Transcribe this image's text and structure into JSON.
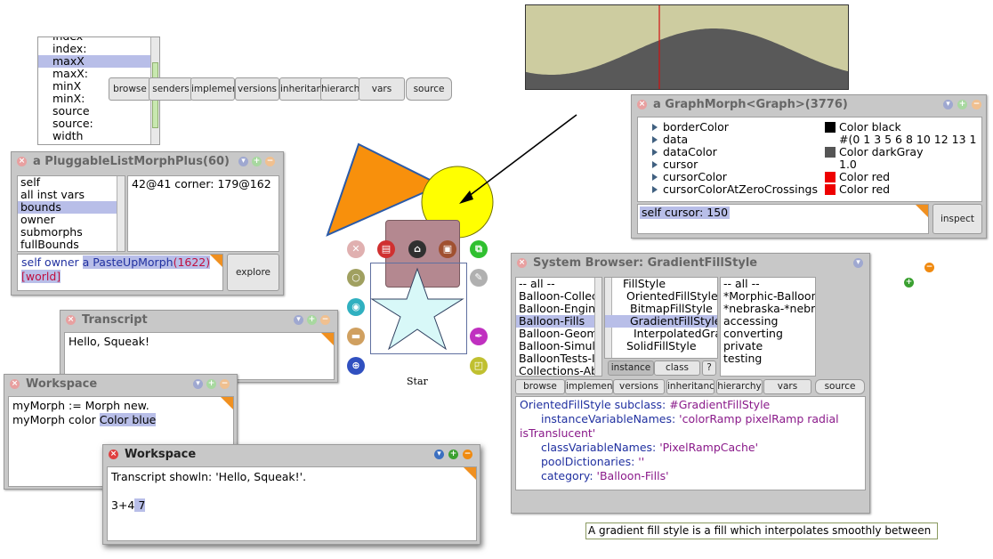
{
  "inspector_list": {
    "items": [
      "index",
      "index:",
      "maxX",
      "maxX:",
      "minX",
      "minX:",
      "source",
      "source:",
      "width"
    ],
    "selected_index": 2
  },
  "top_buttons": [
    "browse",
    "senders",
    "implementors",
    "versions",
    "inheritance",
    "hierarchy",
    "vars",
    "source"
  ],
  "graph_display": {
    "bg_color": "#cdcca0",
    "wave_color": "#595959",
    "cursor_color": "#d01010"
  },
  "graph_inspector": {
    "title": "a GraphMorph<Graph>(3776)",
    "fields": [
      {
        "name": "borderColor",
        "value": "Color black",
        "swatch": "#000000"
      },
      {
        "name": "data",
        "value": "#(0 1 3 5 6 8 10 12 13 1",
        "swatch": ""
      },
      {
        "name": "dataColor",
        "value": "Color darkGray",
        "swatch": "#555555"
      },
      {
        "name": "cursor",
        "value": "1.0",
        "swatch": ""
      },
      {
        "name": "cursorColor",
        "value": "Color red",
        "swatch": "#ee0000"
      },
      {
        "name": "cursorColorAtZeroCrossings",
        "value": "Color red",
        "swatch": "#ee0000"
      }
    ],
    "code": "self cursor: 150",
    "inspect_label": "inspect"
  },
  "pluggable_inspector": {
    "title": "a PluggableListMorphPlus(60)",
    "fields": [
      "self",
      "all inst vars",
      "bounds",
      "owner",
      "submorphs",
      "fullBounds"
    ],
    "selected_index": 2,
    "value": "42@41 corner: 179@162",
    "code_self_owner": "self owner",
    "code_result": "a PasteUpMorph(1622)",
    "code_result_plain": "a PasteUpMorph",
    "code_result_num": "(1622)",
    "code_world": "[world]",
    "explore_label": "explore"
  },
  "transcript": {
    "title": "Transcript",
    "text": "Hello, Squeak!"
  },
  "workspace_back": {
    "title": "Workspace",
    "line1": "myMorph := Morph new.",
    "line2_a": "myMorph color ",
    "line2_b": "Color blue"
  },
  "workspace_front": {
    "title": "Workspace",
    "line1": "Transcript showln: 'Hello, Squeak!'.",
    "line3_a": "3+4",
    "line3_b": " 7"
  },
  "star_morph": {
    "label": "Star",
    "fill": "#d8f8f8"
  },
  "halo_handles": [
    {
      "name": "close-handle-icon",
      "glyph": "✕",
      "color": "#e0b0b0"
    },
    {
      "name": "menu-handle-icon",
      "glyph": "▤",
      "color": "#d03030"
    },
    {
      "name": "grab-handle-icon",
      "glyph": "⌂",
      "color": "#303030"
    },
    {
      "name": "drag-handle-icon",
      "glyph": "▣",
      "color": "#a05030"
    },
    {
      "name": "duplicate-handle-icon",
      "glyph": "⧉",
      "color": "#30c030"
    },
    {
      "name": "collapse-handle-icon",
      "glyph": "○",
      "color": "#a0a060"
    },
    {
      "name": "debug-handle-icon",
      "glyph": "✎",
      "color": "#b0b0b0"
    },
    {
      "name": "viewer-handle-icon",
      "glyph": "◉",
      "color": "#30b0c0"
    },
    {
      "name": "tile-handle-icon",
      "glyph": "▬",
      "color": "#d0a060"
    },
    {
      "name": "color-handle-icon",
      "glyph": "✒",
      "color": "#c030c0"
    },
    {
      "name": "rotate-handle-icon",
      "glyph": "⊕",
      "color": "#3050c0"
    },
    {
      "name": "resize-handle-icon",
      "glyph": "◰",
      "color": "#c0c030"
    }
  ],
  "system_browser": {
    "title": "System Browser: GradientFillStyle",
    "categories": [
      "-- all --",
      "Balloon-Collec",
      "Balloon-Engine",
      "Balloon-Fills",
      "Balloon-Geom",
      "Balloon-Simula",
      "BalloonTests-I",
      "Collections-Ab"
    ],
    "categories_selected": 3,
    "classes": [
      "FillStyle",
      "OrientedFillStyle",
      "BitmapFillStyle",
      "GradientFillStyle",
      "InterpolatedGra",
      "SolidFillStyle"
    ],
    "classes_selected": 3,
    "protocols": [
      "-- all --",
      "*Morphic-Balloon",
      "*nebraska-*nebr",
      "accessing",
      "converting",
      "private",
      "testing"
    ],
    "instance_label": "instance",
    "class_label": "class",
    "q_label": "?",
    "buttons": [
      "browse",
      "implementors",
      "versions",
      "inheritance",
      "hierarchy",
      "vars",
      "source"
    ],
    "code": {
      "l1_a": "OrientedFillStyle",
      "l1_b": " subclass: ",
      "l1_c": "#GradientFillStyle",
      "l2_a": "instanceVariableNames: ",
      "l2_b": "'colorRamp pixelRamp radial",
      "l3": "isTranslucent'",
      "l4_a": "classVariableNames: ",
      "l4_b": "'PixelRampCache'",
      "l5_a": "poolDictionaries: ",
      "l5_b": "''",
      "l6_a": "category: ",
      "l6_b": "'Balloon-Fills'"
    }
  },
  "balloon_help": "A gradient fill style is a fill which interpolates smoothly between"
}
